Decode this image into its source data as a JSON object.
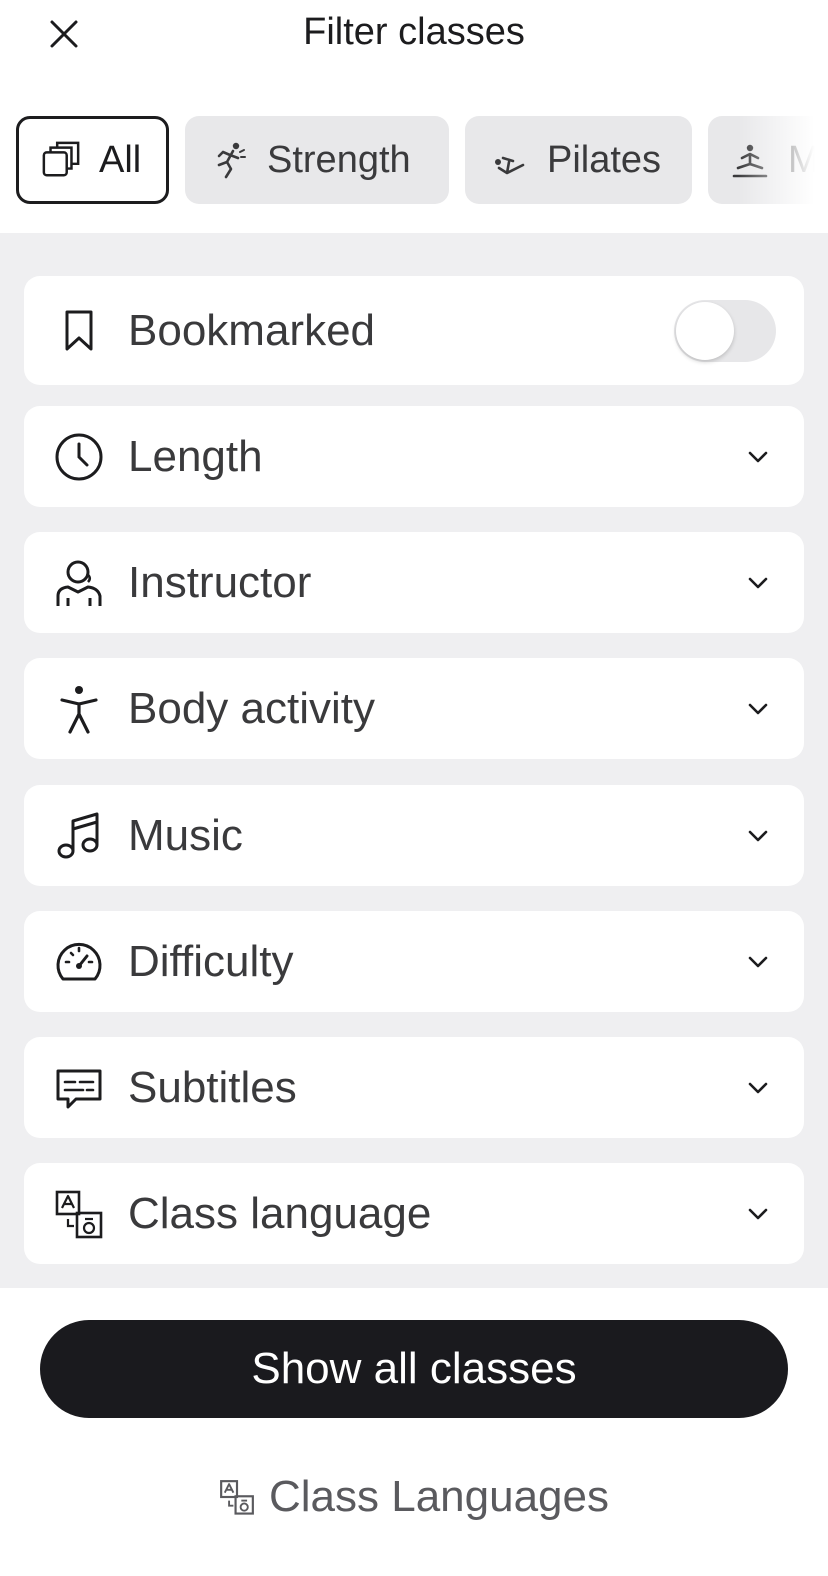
{
  "header": {
    "title": "Filter classes",
    "close_icon": "close-icon"
  },
  "categories": [
    {
      "label": "All",
      "icon": "stack-icon",
      "selected": true
    },
    {
      "label": "Strength",
      "icon": "strength-runner-icon",
      "selected": false
    },
    {
      "label": "Pilates",
      "icon": "pilates-icon",
      "selected": false
    },
    {
      "label": "M",
      "icon": "meditation-icon",
      "selected": false
    }
  ],
  "filters": {
    "bookmarked": {
      "label": "Bookmarked",
      "icon": "bookmark-icon",
      "toggle_on": false
    },
    "length": {
      "label": "Length",
      "icon": "clock-icon"
    },
    "instructor": {
      "label": "Instructor",
      "icon": "instructor-icon"
    },
    "body_activity": {
      "label": "Body activity",
      "icon": "body-icon"
    },
    "music": {
      "label": "Music",
      "icon": "music-note-icon"
    },
    "difficulty": {
      "label": "Difficulty",
      "icon": "gauge-icon"
    },
    "subtitles": {
      "label": "Subtitles",
      "icon": "subtitles-icon"
    },
    "class_language": {
      "label": "Class language",
      "icon": "translate-icon"
    }
  },
  "cta": {
    "label": "Show all classes"
  },
  "footer": {
    "label": "Class Languages",
    "icon": "translate-icon"
  },
  "colors": {
    "primary_dark": "#1a1a1e",
    "panel_bg": "#efeff1",
    "chip_bg": "#e8e8ea",
    "text": "#3a3a3c"
  }
}
